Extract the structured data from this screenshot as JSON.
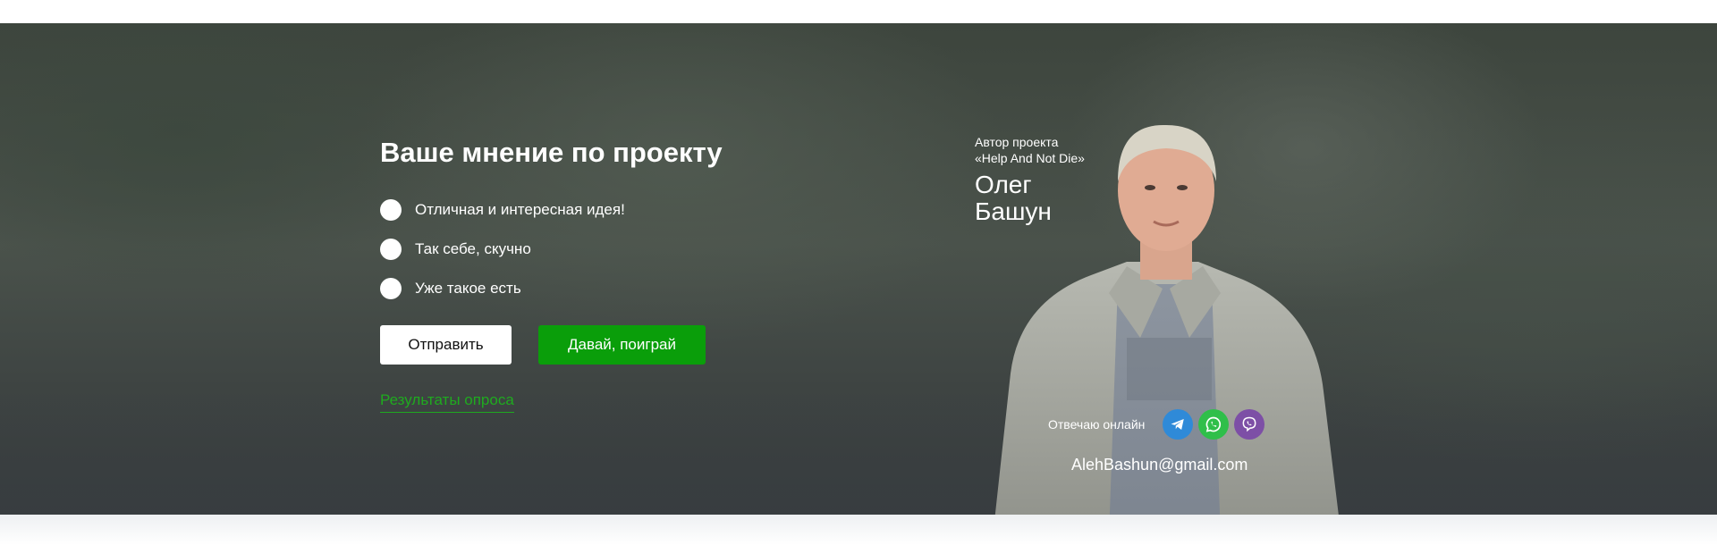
{
  "poll": {
    "title": "Ваше мнение по проекту",
    "options": [
      {
        "label": "Отличная и интересная идея!"
      },
      {
        "label": "Так себе, скучно"
      },
      {
        "label": "Уже такое есть"
      }
    ],
    "submit_label": "Отправить",
    "play_label": "Давай, поиграй",
    "results_link": "Результаты опроса"
  },
  "author": {
    "caption_line1": "Автор проекта",
    "caption_line2": "«Help And Not Die»",
    "first_name": "Олег",
    "last_name": "Башун"
  },
  "contact": {
    "online_label": "Отвечаю онлайн",
    "messengers": [
      {
        "icon": "telegram-icon",
        "color": "#2f8ad8"
      },
      {
        "icon": "whatsapp-icon",
        "color": "#2fbf4a"
      },
      {
        "icon": "viber-icon",
        "color": "#7d4fa6"
      }
    ],
    "email": "AlehBashun@gmail.com"
  },
  "colors": {
    "accent_green": "#0a9e0a",
    "link_green": "#1faa1f",
    "banner_bg": "#444b46"
  }
}
